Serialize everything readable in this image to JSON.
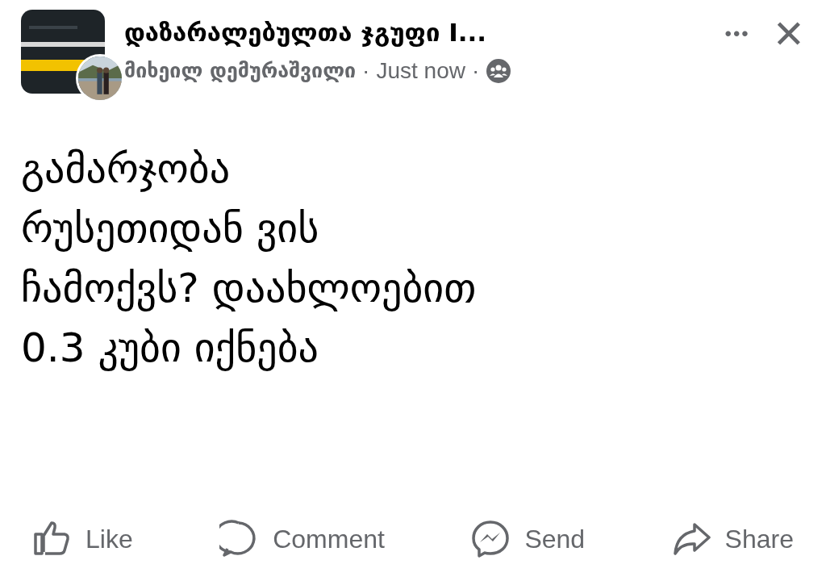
{
  "post": {
    "group_name": "დაზარალებულთა ჯგუფი I...",
    "author": "მიხეილ დემურაშვილი",
    "separator_1": "·",
    "time": "Just now",
    "separator_2": "·",
    "more": "•••",
    "close": "✕",
    "text_lines": [
      "გამარჯობა",
      "რუსეთიდან ვის",
      "ჩამოქვს? დაახლოებით",
      "0.3 კუბი იქნება"
    ]
  },
  "actions": [
    {
      "kind": "like",
      "label": "Like"
    },
    {
      "kind": "comment",
      "label": "Comment"
    },
    {
      "kind": "send",
      "label": "Send"
    },
    {
      "kind": "share",
      "label": "Share"
    }
  ]
}
